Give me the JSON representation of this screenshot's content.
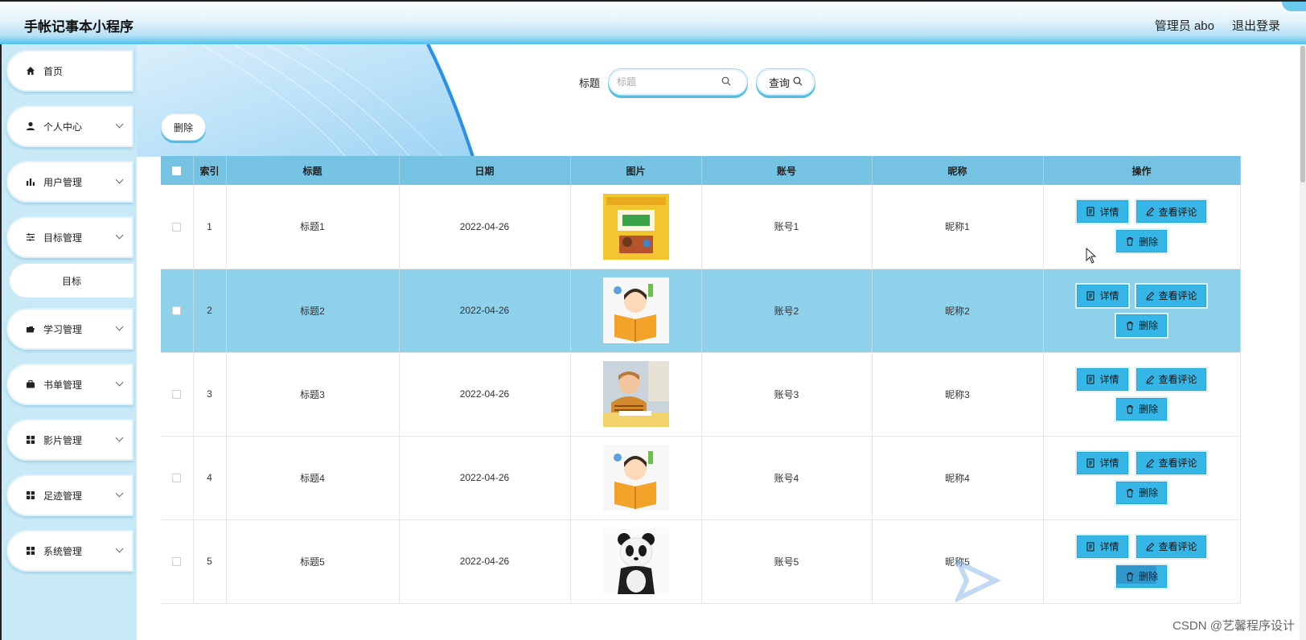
{
  "app": {
    "title": "手帐记事本小程序"
  },
  "header": {
    "user": "管理员 abo",
    "logout": "退出登录"
  },
  "sidebar": {
    "items": [
      {
        "label": "首页",
        "icon": "home-icon",
        "expandable": false
      },
      {
        "label": "个人中心",
        "icon": "user-icon",
        "expandable": true
      },
      {
        "label": "用户管理",
        "icon": "bar-chart-icon",
        "expandable": true
      },
      {
        "label": "目标管理",
        "icon": "sliders-icon",
        "expandable": true
      },
      {
        "label": "学习管理",
        "icon": "folder-open-icon",
        "expandable": true
      },
      {
        "label": "书单管理",
        "icon": "briefcase-icon",
        "expandable": true
      },
      {
        "label": "影片管理",
        "icon": "grid-icon",
        "expandable": true
      },
      {
        "label": "足迹管理",
        "icon": "grid-icon",
        "expandable": true
      },
      {
        "label": "系统管理",
        "icon": "grid-icon",
        "expandable": true
      }
    ],
    "sub_item": "目标"
  },
  "search": {
    "label": "标题",
    "placeholder": "标题",
    "value": "",
    "button": "查询"
  },
  "toolbar": {
    "delete_label": "删除"
  },
  "table": {
    "columns": [
      "",
      "索引",
      "标题",
      "日期",
      "图片",
      "账号",
      "昵称",
      "操作"
    ],
    "actions": {
      "detail": "详情",
      "comments": "查看评论",
      "delete": "删除"
    },
    "rows": [
      {
        "index": "1",
        "title": "标题1",
        "date": "2022-04-26",
        "image": "book-cover-image",
        "account": "账号1",
        "nickname": "昵称1"
      },
      {
        "index": "2",
        "title": "标题2",
        "date": "2022-04-26",
        "image": "child-reading-illustration",
        "account": "账号2",
        "nickname": "昵称2"
      },
      {
        "index": "3",
        "title": "标题3",
        "date": "2022-04-26",
        "image": "boy-studying-photo",
        "account": "账号3",
        "nickname": "昵称3"
      },
      {
        "index": "4",
        "title": "标题4",
        "date": "2022-04-26",
        "image": "child-reading-illustration",
        "account": "账号4",
        "nickname": "昵称4"
      },
      {
        "index": "5",
        "title": "标题5",
        "date": "2022-04-26",
        "image": "panda-photo",
        "account": "账号5",
        "nickname": "昵称5"
      }
    ]
  },
  "watermark": "CSDN @艺馨程序设计"
}
